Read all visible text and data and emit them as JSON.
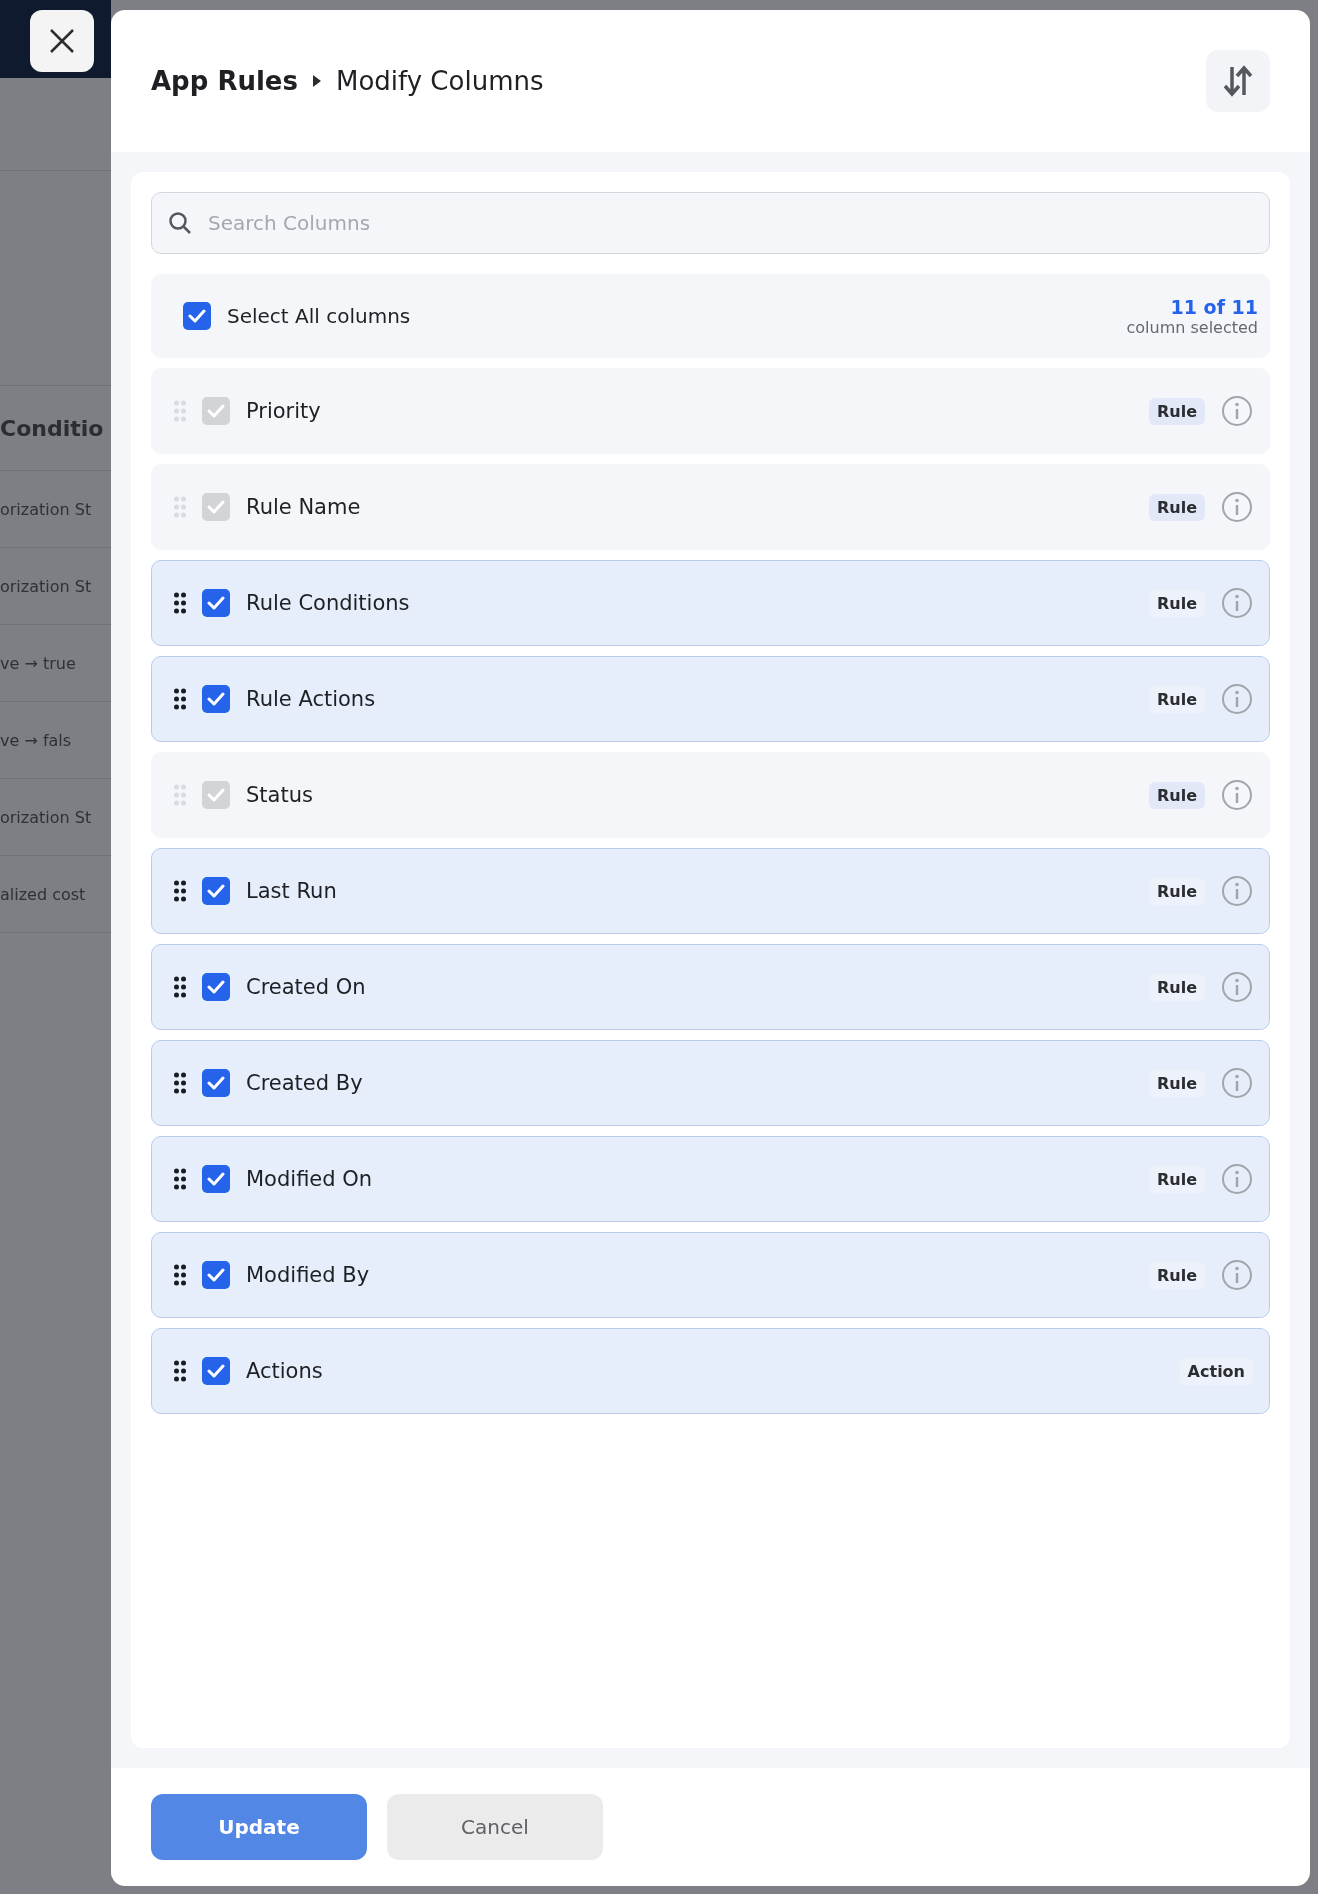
{
  "background": {
    "header": "Conditio",
    "cells": [
      "orization St",
      "orization St",
      "ve → true",
      "ve → fals",
      "orization St",
      "alized cost"
    ]
  },
  "header": {
    "breadcrumb": [
      "App Rules",
      "Modify Columns"
    ]
  },
  "search": {
    "placeholder": "Search Columns"
  },
  "select_all": {
    "label": "Select All columns",
    "checked": true,
    "count": "11 of 11",
    "caption": "column selected"
  },
  "columns": [
    {
      "label": "Priority",
      "checked": true,
      "locked": true,
      "tag": "Rule",
      "info": true
    },
    {
      "label": "Rule Name",
      "checked": true,
      "locked": true,
      "tag": "Rule",
      "info": true
    },
    {
      "label": "Rule Conditions",
      "checked": true,
      "locked": false,
      "tag": "Rule",
      "info": true
    },
    {
      "label": "Rule Actions",
      "checked": true,
      "locked": false,
      "tag": "Rule",
      "info": true
    },
    {
      "label": "Status",
      "checked": true,
      "locked": true,
      "tag": "Rule",
      "info": true
    },
    {
      "label": "Last Run",
      "checked": true,
      "locked": false,
      "tag": "Rule",
      "info": true
    },
    {
      "label": "Created On",
      "checked": true,
      "locked": false,
      "tag": "Rule",
      "info": true
    },
    {
      "label": "Created By",
      "checked": true,
      "locked": false,
      "tag": "Rule",
      "info": true
    },
    {
      "label": "Modified On",
      "checked": true,
      "locked": false,
      "tag": "Rule",
      "info": true
    },
    {
      "label": "Modified By",
      "checked": true,
      "locked": false,
      "tag": "Rule",
      "info": true
    },
    {
      "label": "Actions",
      "checked": true,
      "locked": false,
      "tag": "Action",
      "info": false
    }
  ],
  "footer": {
    "buttons": [
      {
        "label": "Update",
        "kind": "primary"
      },
      {
        "label": "Cancel",
        "kind": "secondary"
      }
    ]
  }
}
